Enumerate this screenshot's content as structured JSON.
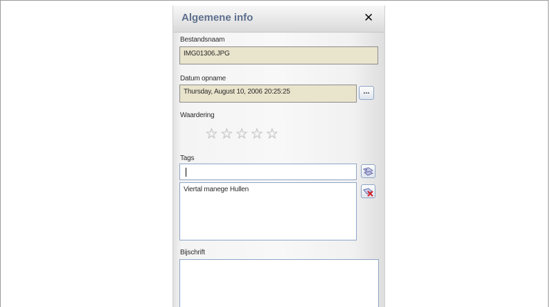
{
  "panel": {
    "title": "Algemene info",
    "close_icon": "close-icon"
  },
  "filename": {
    "label": "Bestandsnaam",
    "value": "IMG01306.JPG"
  },
  "date_taken": {
    "label": "Datum opname",
    "value": "Thursday, August 10, 2006 20:25:25",
    "browse_label": "..."
  },
  "rating": {
    "label": "Waardering",
    "stars": 5,
    "value": 0
  },
  "tags": {
    "label": "Tags",
    "input_value": "",
    "add_icon": "tag-add-icon",
    "remove_icon": "tag-remove-icon",
    "items": [
      "Viertal manege Hullen"
    ]
  },
  "caption": {
    "label": "Bijschrift",
    "value": ""
  },
  "colors": {
    "title": "#5d6f8d",
    "readonly_field": "#e9e4cc"
  }
}
